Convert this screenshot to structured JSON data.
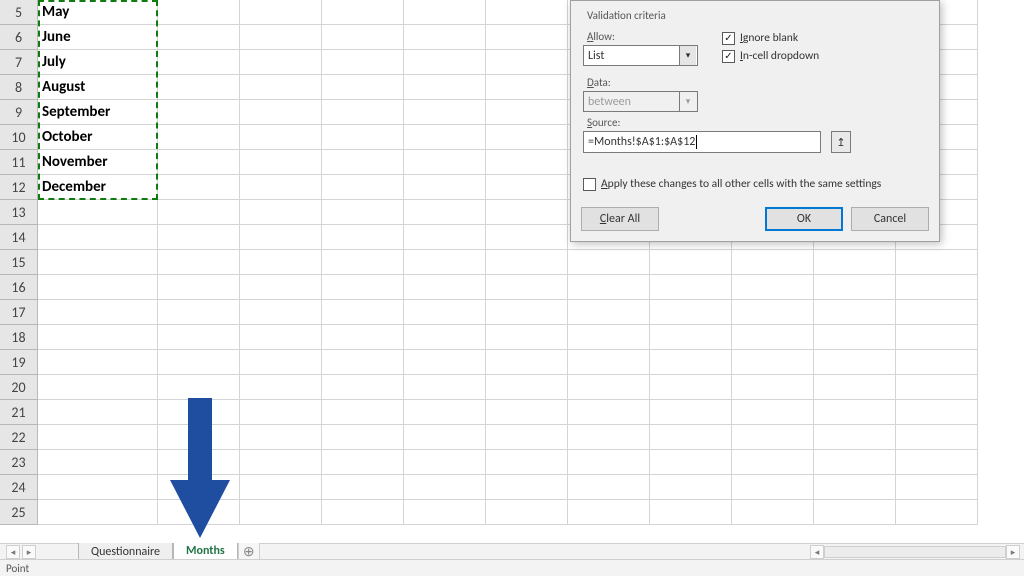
{
  "rows": [
    {
      "n": 5,
      "a": "May"
    },
    {
      "n": 6,
      "a": "June"
    },
    {
      "n": 7,
      "a": "July"
    },
    {
      "n": 8,
      "a": "August"
    },
    {
      "n": 9,
      "a": "September"
    },
    {
      "n": 10,
      "a": "October"
    },
    {
      "n": 11,
      "a": "November"
    },
    {
      "n": 12,
      "a": "December"
    },
    {
      "n": 13,
      "a": ""
    },
    {
      "n": 14,
      "a": ""
    },
    {
      "n": 15,
      "a": ""
    },
    {
      "n": 16,
      "a": ""
    },
    {
      "n": 17,
      "a": ""
    },
    {
      "n": 18,
      "a": ""
    },
    {
      "n": 19,
      "a": ""
    },
    {
      "n": 20,
      "a": ""
    },
    {
      "n": 21,
      "a": ""
    },
    {
      "n": 22,
      "a": ""
    },
    {
      "n": 23,
      "a": ""
    },
    {
      "n": 24,
      "a": ""
    },
    {
      "n": 25,
      "a": ""
    }
  ],
  "dialog": {
    "group": "Validation criteria",
    "allow_label": "Allow:",
    "allow_value": "List",
    "data_label": "Data:",
    "data_value": "between",
    "source_label": "Source:",
    "source_value": "=Months!$A$1:$A$12",
    "ignore_blank": "Ignore blank",
    "incell_dropdown": "In-cell dropdown",
    "apply": "Apply these changes to all other cells with the same settings",
    "clear": "Clear All",
    "ok": "OK",
    "cancel": "Cancel"
  },
  "tabs": {
    "t1": "Questionnaire",
    "t2": "Months"
  },
  "status": "Point"
}
